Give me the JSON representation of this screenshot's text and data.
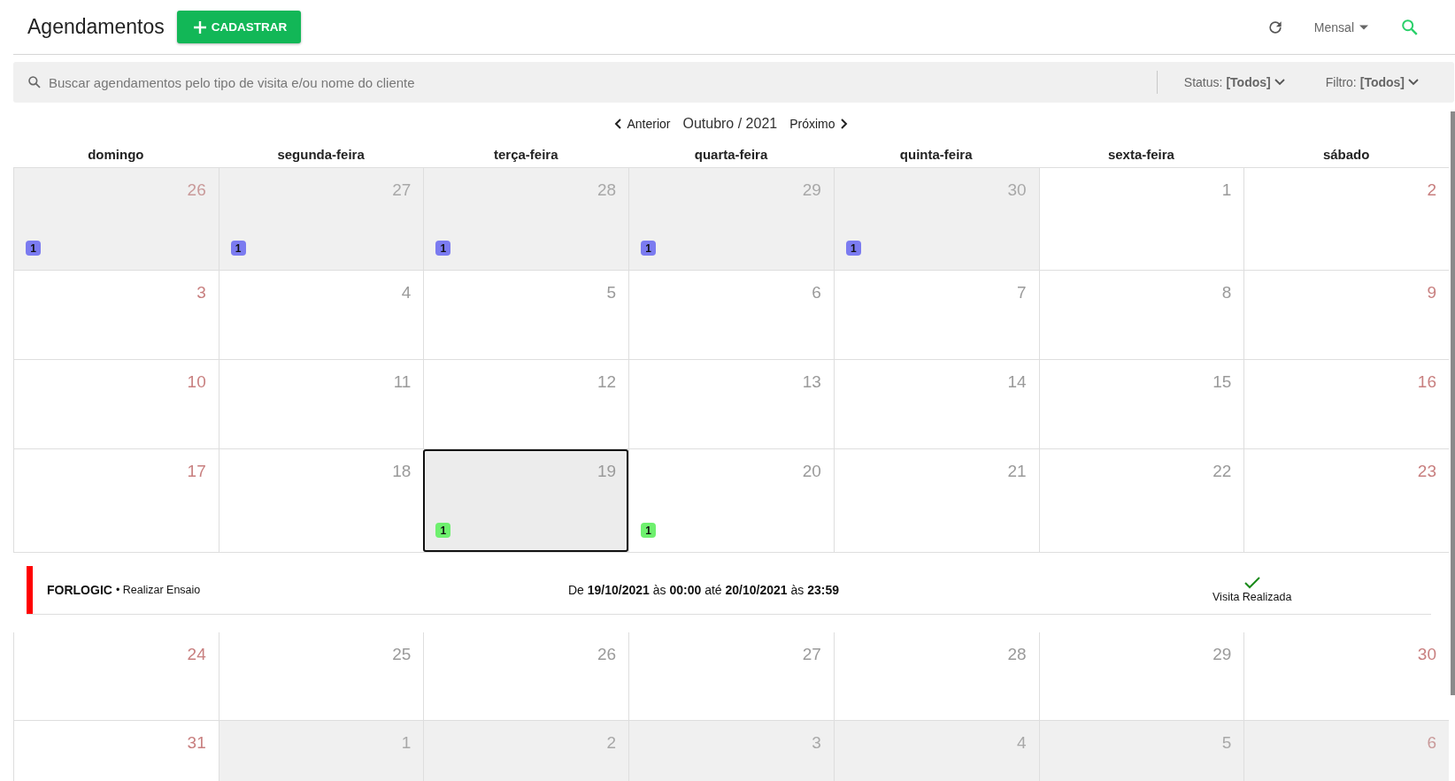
{
  "header": {
    "title": "Agendamentos",
    "add_button": "CADASTRAR",
    "view": "Mensal"
  },
  "search": {
    "placeholder": "Buscar agendamentos pelo tipo de visita e/ou nome do cliente"
  },
  "filters": [
    {
      "label": "Status:",
      "value": "[Todos]"
    },
    {
      "label": "Filtro:",
      "value": "[Todos]"
    }
  ],
  "nav": {
    "previous": "Anterior",
    "month": "Outubro / 2021",
    "next": "Próximo"
  },
  "weekdays": [
    "domingo",
    "segunda-feira",
    "terça-feira",
    "quarta-feira",
    "quinta-feira",
    "sexta-feira",
    "sábado"
  ],
  "weeks": [
    {
      "days": [
        {
          "day": "26",
          "muted": true,
          "selected": false,
          "badge": {
            "count": "1",
            "color": "#7b7bf0"
          }
        },
        {
          "day": "27",
          "muted": true,
          "selected": false,
          "badge": {
            "count": "1",
            "color": "#7b7bf0"
          }
        },
        {
          "day": "28",
          "muted": true,
          "selected": false,
          "badge": {
            "count": "1",
            "color": "#7b7bf0"
          }
        },
        {
          "day": "29",
          "muted": true,
          "selected": false,
          "badge": {
            "count": "1",
            "color": "#7b7bf0"
          }
        },
        {
          "day": "30",
          "muted": true,
          "selected": false,
          "badge": {
            "count": "1",
            "color": "#7b7bf0"
          }
        },
        {
          "day": "1",
          "muted": false,
          "selected": false
        },
        {
          "day": "2",
          "muted": false,
          "selected": false
        }
      ]
    },
    {
      "days": [
        {
          "day": "3",
          "muted": false,
          "selected": false
        },
        {
          "day": "4",
          "muted": false,
          "selected": false
        },
        {
          "day": "5",
          "muted": false,
          "selected": false
        },
        {
          "day": "6",
          "muted": false,
          "selected": false
        },
        {
          "day": "7",
          "muted": false,
          "selected": false
        },
        {
          "day": "8",
          "muted": false,
          "selected": false
        },
        {
          "day": "9",
          "muted": false,
          "selected": false
        }
      ]
    },
    {
      "days": [
        {
          "day": "10",
          "muted": false,
          "selected": false
        },
        {
          "day": "11",
          "muted": false,
          "selected": false
        },
        {
          "day": "12",
          "muted": false,
          "selected": false
        },
        {
          "day": "13",
          "muted": false,
          "selected": false
        },
        {
          "day": "14",
          "muted": false,
          "selected": false
        },
        {
          "day": "15",
          "muted": false,
          "selected": false
        },
        {
          "day": "16",
          "muted": false,
          "selected": false
        }
      ]
    },
    {
      "days": [
        {
          "day": "17",
          "muted": false,
          "selected": false
        },
        {
          "day": "18",
          "muted": false,
          "selected": false
        },
        {
          "day": "19",
          "muted": false,
          "selected": true,
          "badge": {
            "count": "1",
            "color": "#6ef06e"
          }
        },
        {
          "day": "20",
          "muted": false,
          "selected": false,
          "badge": {
            "count": "1",
            "color": "#6ef06e"
          }
        },
        {
          "day": "21",
          "muted": false,
          "selected": false
        },
        {
          "day": "22",
          "muted": false,
          "selected": false
        },
        {
          "day": "23",
          "muted": false,
          "selected": false
        }
      ],
      "event": {
        "client": "FORLOGIC",
        "type": "• Realizar Ensaio",
        "period": "De **19/10/2021** às **00:00** até **20/10/2021** às **23:59**",
        "status": "Visita Realizada",
        "color": "#ff0000"
      }
    },
    {
      "days": [
        {
          "day": "24",
          "muted": false,
          "selected": false
        },
        {
          "day": "25",
          "muted": false,
          "selected": false
        },
        {
          "day": "26",
          "muted": false,
          "selected": false
        },
        {
          "day": "27",
          "muted": false,
          "selected": false
        },
        {
          "day": "28",
          "muted": false,
          "selected": false
        },
        {
          "day": "29",
          "muted": false,
          "selected": false
        },
        {
          "day": "30",
          "muted": false,
          "selected": false
        }
      ]
    },
    {
      "days": [
        {
          "day": "31",
          "muted": false,
          "selected": false
        },
        {
          "day": "1",
          "muted": true,
          "selected": false
        },
        {
          "day": "2",
          "muted": true,
          "selected": false
        },
        {
          "day": "3",
          "muted": true,
          "selected": false
        },
        {
          "day": "4",
          "muted": true,
          "selected": false
        },
        {
          "day": "5",
          "muted": true,
          "selected": false
        },
        {
          "day": "6",
          "muted": true,
          "selected": false
        }
      ]
    }
  ]
}
